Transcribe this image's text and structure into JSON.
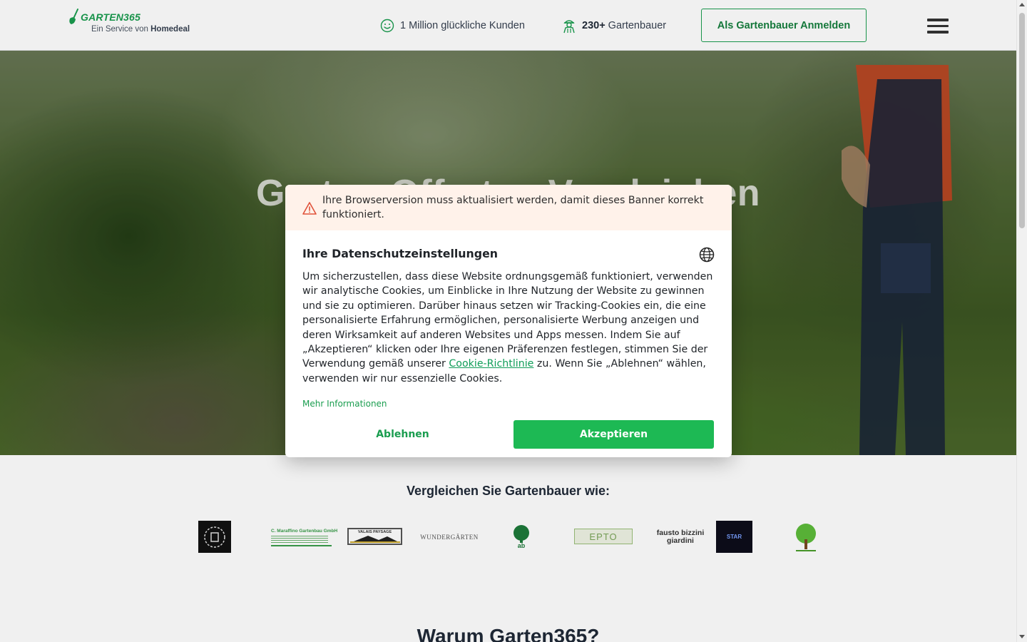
{
  "header": {
    "logo_brand": "GARTEN365",
    "logo_sub_prefix": "Ein Service von",
    "logo_sub_brand": "Homedeal",
    "stat_customers": "1 Million glückliche Kunden",
    "stat_gardeners_count": "230+",
    "stat_gardeners_label": "Gartenbauer",
    "register_label": "Als Gartenbauer Anmelden"
  },
  "hero": {
    "title": "Garten-Offerten Vergleichen"
  },
  "compare": {
    "title": "Vergleichen Sie Gartenbauer wie:",
    "partners": [
      {
        "icon": "leaf-emblem-logo"
      },
      {
        "text": "C. Maraffino Gartenbau GmbH"
      },
      {
        "text": "VALAIS PAYSAGE"
      },
      {
        "text": "WUNDERGÄRTEN"
      },
      {
        "text": "ab"
      },
      {
        "text": "EPTO"
      },
      {
        "text": "fausto bizzini giardini"
      },
      {
        "text": "STAR"
      },
      {
        "icon": "tree-logo"
      }
    ]
  },
  "why": {
    "title": "Warum Garten365?"
  },
  "cookie_modal": {
    "warning": "Ihre Browserversion muss aktualisiert werden, damit dieses Banner korrekt funktioniert.",
    "title": "Ihre Datenschutzeinstellungen",
    "body_before_link": "Um sicherzustellen, dass diese Website ordnungsgemäß funktioniert, verwenden wir analytische Cookies, um Einblicke in Ihre Nutzung der Website zu gewinnen und sie zu optimieren. Darüber hinaus setzen wir Tracking-Cookies ein, die eine personalisierte Erfahrung ermöglichen, personalisierte Werbung anzeigen und deren Wirksamkeit auf anderen Websites und Apps messen. Indem Sie auf „Akzeptieren“ klicken oder Ihre eigenen Präferenzen festlegen, stimmen Sie der Verwendung gemäß unserer ",
    "body_link": "Cookie-Richtlinie",
    "body_after_link": " zu. Wenn Sie „Ablehnen“ wählen, verwenden wir nur essenzielle Cookies.",
    "more_info": "Mehr Informationen",
    "reject_label": "Ablehnen",
    "accept_label": "Akzeptieren"
  },
  "colors": {
    "brand_green": "#1a9d4f",
    "accept_green": "#1db954",
    "warning_bg": "#fff2ea",
    "warning_icon": "#e0523a"
  }
}
